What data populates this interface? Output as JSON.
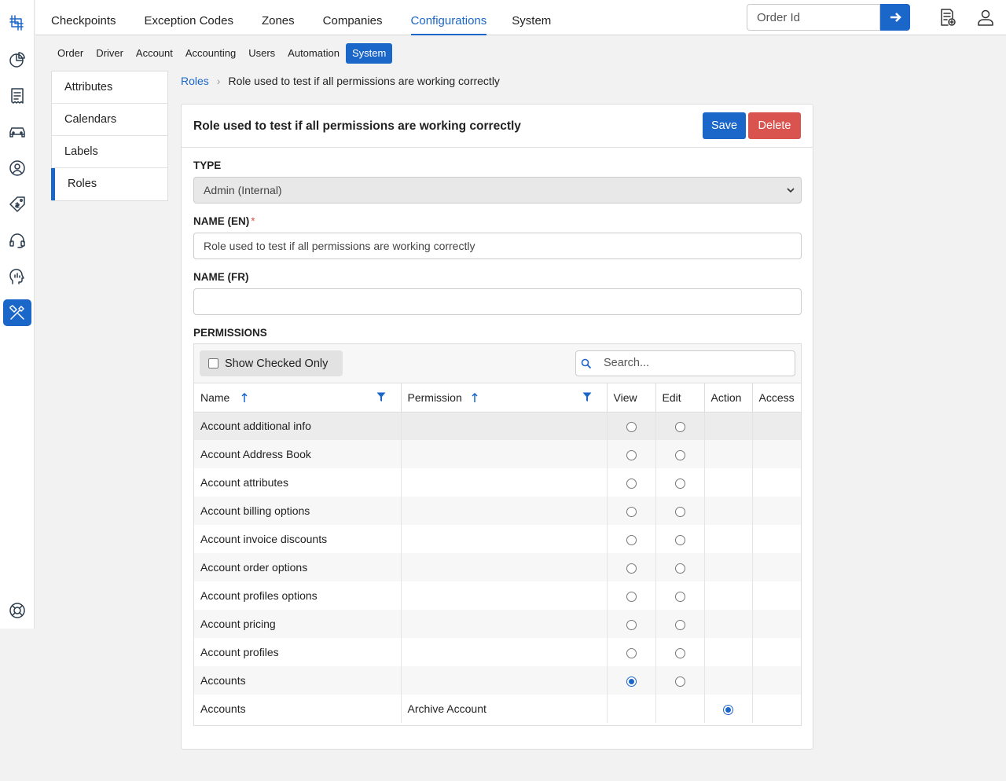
{
  "topnav": {
    "items": [
      "Checkpoints",
      "Exception Codes",
      "Zones",
      "Companies",
      "Configurations",
      "System"
    ],
    "active_index": 4
  },
  "order_search": {
    "placeholder": "Order Id"
  },
  "subnav": {
    "items": [
      "Order",
      "Driver",
      "Account",
      "Accounting",
      "Users",
      "Automation",
      "System"
    ],
    "active_index": 6
  },
  "sidemenu": {
    "items": [
      "Attributes",
      "Calendars",
      "Labels",
      "Roles"
    ],
    "active_index": 3
  },
  "breadcrumb": {
    "parent": "Roles",
    "current": "Role used to test if all permissions are working correctly"
  },
  "card": {
    "title": "Role used to test if all permissions are working correctly",
    "save_label": "Save",
    "delete_label": "Delete"
  },
  "form": {
    "type_label": "TYPE",
    "type_value": "Admin (Internal)",
    "name_en_label": "NAME (EN)",
    "name_en_value": "Role used to test if all permissions are working correctly",
    "name_fr_label": "NAME (FR)",
    "name_fr_value": "",
    "permissions_label": "PERMISSIONS"
  },
  "permissions": {
    "show_checked_label": "Show Checked Only",
    "search_placeholder": "Search...",
    "columns": [
      "Name",
      "Permission",
      "View",
      "Edit",
      "Action",
      "Access"
    ],
    "rows": [
      {
        "name": "Account additional info",
        "permission": "",
        "view": false,
        "edit": false,
        "action": null,
        "access": null
      },
      {
        "name": "Account Address Book",
        "permission": "",
        "view": false,
        "edit": false,
        "action": null,
        "access": null
      },
      {
        "name": "Account attributes",
        "permission": "",
        "view": false,
        "edit": false,
        "action": null,
        "access": null
      },
      {
        "name": "Account billing options",
        "permission": "",
        "view": false,
        "edit": false,
        "action": null,
        "access": null
      },
      {
        "name": "Account invoice discounts",
        "permission": "",
        "view": false,
        "edit": false,
        "action": null,
        "access": null
      },
      {
        "name": "Account order options",
        "permission": "",
        "view": false,
        "edit": false,
        "action": null,
        "access": null
      },
      {
        "name": "Account profiles options",
        "permission": "",
        "view": false,
        "edit": false,
        "action": null,
        "access": null
      },
      {
        "name": "Account pricing",
        "permission": "",
        "view": false,
        "edit": false,
        "action": null,
        "access": null
      },
      {
        "name": "Account profiles",
        "permission": "",
        "view": false,
        "edit": false,
        "action": null,
        "access": null
      },
      {
        "name": "Accounts",
        "permission": "",
        "view": true,
        "edit": false,
        "action": null,
        "access": null
      },
      {
        "name": "Accounts",
        "permission": "Archive Account",
        "view": null,
        "edit": null,
        "action": true,
        "access": null
      }
    ]
  },
  "colors": {
    "primary": "#1b66c9",
    "danger": "#d9534f"
  }
}
